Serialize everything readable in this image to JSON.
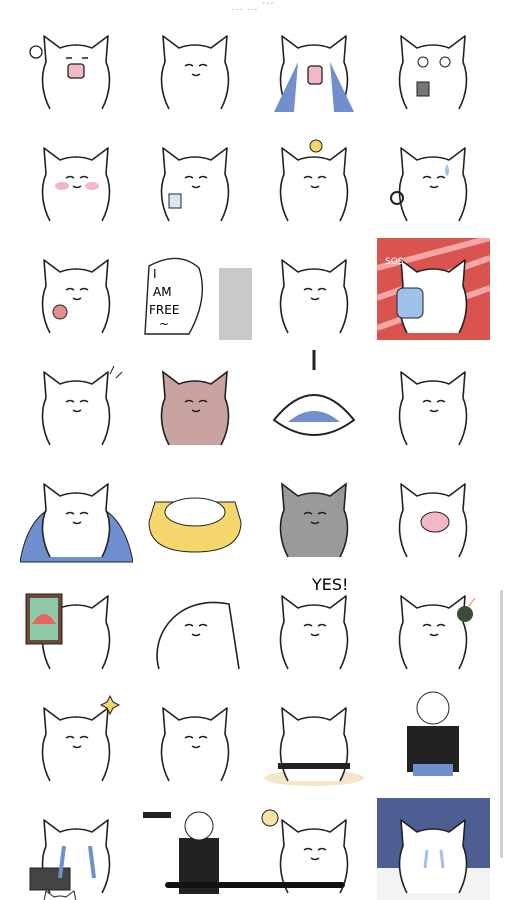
{
  "top_indicator": "... ...  ´´´",
  "sticker_grid": {
    "stickers": [
      {
        "name": "cat-shouting"
      },
      {
        "name": "cat-calm"
      },
      {
        "name": "cat-crying-streams"
      },
      {
        "name": "cat-dazed-phone"
      },
      {
        "name": "cat-blushing"
      },
      {
        "name": "cat-drinking"
      },
      {
        "name": "cat-chick-on-head"
      },
      {
        "name": "cat-sweating-hairdryer"
      },
      {
        "name": "cat-lollipop"
      },
      {
        "name": "cat-i-am-free"
      },
      {
        "name": "cat-chubby"
      },
      {
        "name": "cat-sos-drink"
      },
      {
        "name": "cat-thumbs-up"
      },
      {
        "name": "cat-embarrassed-pink"
      },
      {
        "name": "cat-punching-bag"
      },
      {
        "name": "cat-standing"
      },
      {
        "name": "cat-wrapped-blue-blanket"
      },
      {
        "name": "cat-in-yellow-bed"
      },
      {
        "name": "cat-grey-shadow"
      },
      {
        "name": "cat-wide-mouth"
      },
      {
        "name": "cat-watermelon-frame"
      },
      {
        "name": "cat-peeking"
      },
      {
        "name": "cat-yes"
      },
      {
        "name": "cat-bomb"
      },
      {
        "name": "cat-sparkle-salute"
      },
      {
        "name": "cat-stretching"
      },
      {
        "name": "cat-grumpy-table"
      },
      {
        "name": "cat-glasses-sitting"
      },
      {
        "name": "cat-crying-laptop"
      },
      {
        "name": "cat-tophat-suit"
      },
      {
        "name": "cat-lightbulb-idea"
      },
      {
        "name": "cat-crying-night-desk"
      }
    ],
    "texts": {
      "free_line1": "I",
      "free_line2": "AM",
      "free_line3": "FREE",
      "free_tilde": "~",
      "sos": "SOS",
      "yes": "YES!"
    }
  },
  "colors": {
    "outline": "#222222",
    "blue": "#6f8fce",
    "pink": "#f2b8c6",
    "yellow": "#f5d76e",
    "red": "#d9534f",
    "grey": "#9a9a9a",
    "night": "#4d5f92"
  }
}
